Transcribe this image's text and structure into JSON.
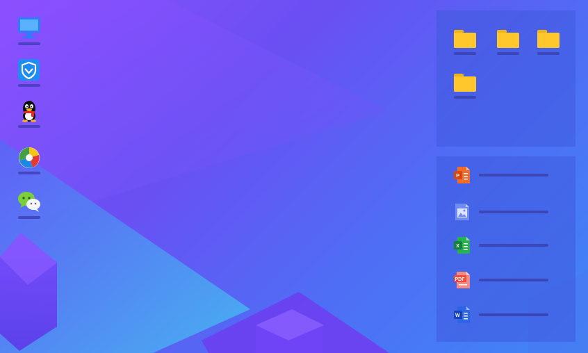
{
  "desktop": {
    "left_icons": [
      {
        "icon": "computer-icon",
        "label": ""
      },
      {
        "icon": "security-shield-icon",
        "label": ""
      },
      {
        "icon": "qq-penguin-icon",
        "label": ""
      },
      {
        "icon": "browser-icon",
        "label": ""
      },
      {
        "icon": "wechat-icon",
        "label": ""
      }
    ],
    "folder_panel": {
      "folders": [
        {
          "icon": "folder-icon",
          "label": ""
        },
        {
          "icon": "folder-icon",
          "label": ""
        },
        {
          "icon": "folder-icon",
          "label": ""
        },
        {
          "icon": "folder-icon",
          "label": ""
        }
      ]
    },
    "doc_panel": {
      "files": [
        {
          "icon": "powerpoint-file-icon",
          "badge": "P",
          "label": ""
        },
        {
          "icon": "image-file-icon",
          "badge": "",
          "label": ""
        },
        {
          "icon": "excel-file-icon",
          "badge": "X",
          "label": ""
        },
        {
          "icon": "pdf-file-icon",
          "badge": "PDF",
          "label": ""
        },
        {
          "icon": "word-file-icon",
          "badge": "W",
          "label": ""
        }
      ]
    }
  },
  "colors": {
    "folder": "#ffc72c",
    "folder_tab": "#f0b21a",
    "label_bar": "#3b46b8",
    "ppt": "#f36b2b",
    "image": "#6f8cf2",
    "excel": "#27b14f",
    "pdf": "#ef4a3c",
    "word": "#2e64e8"
  }
}
